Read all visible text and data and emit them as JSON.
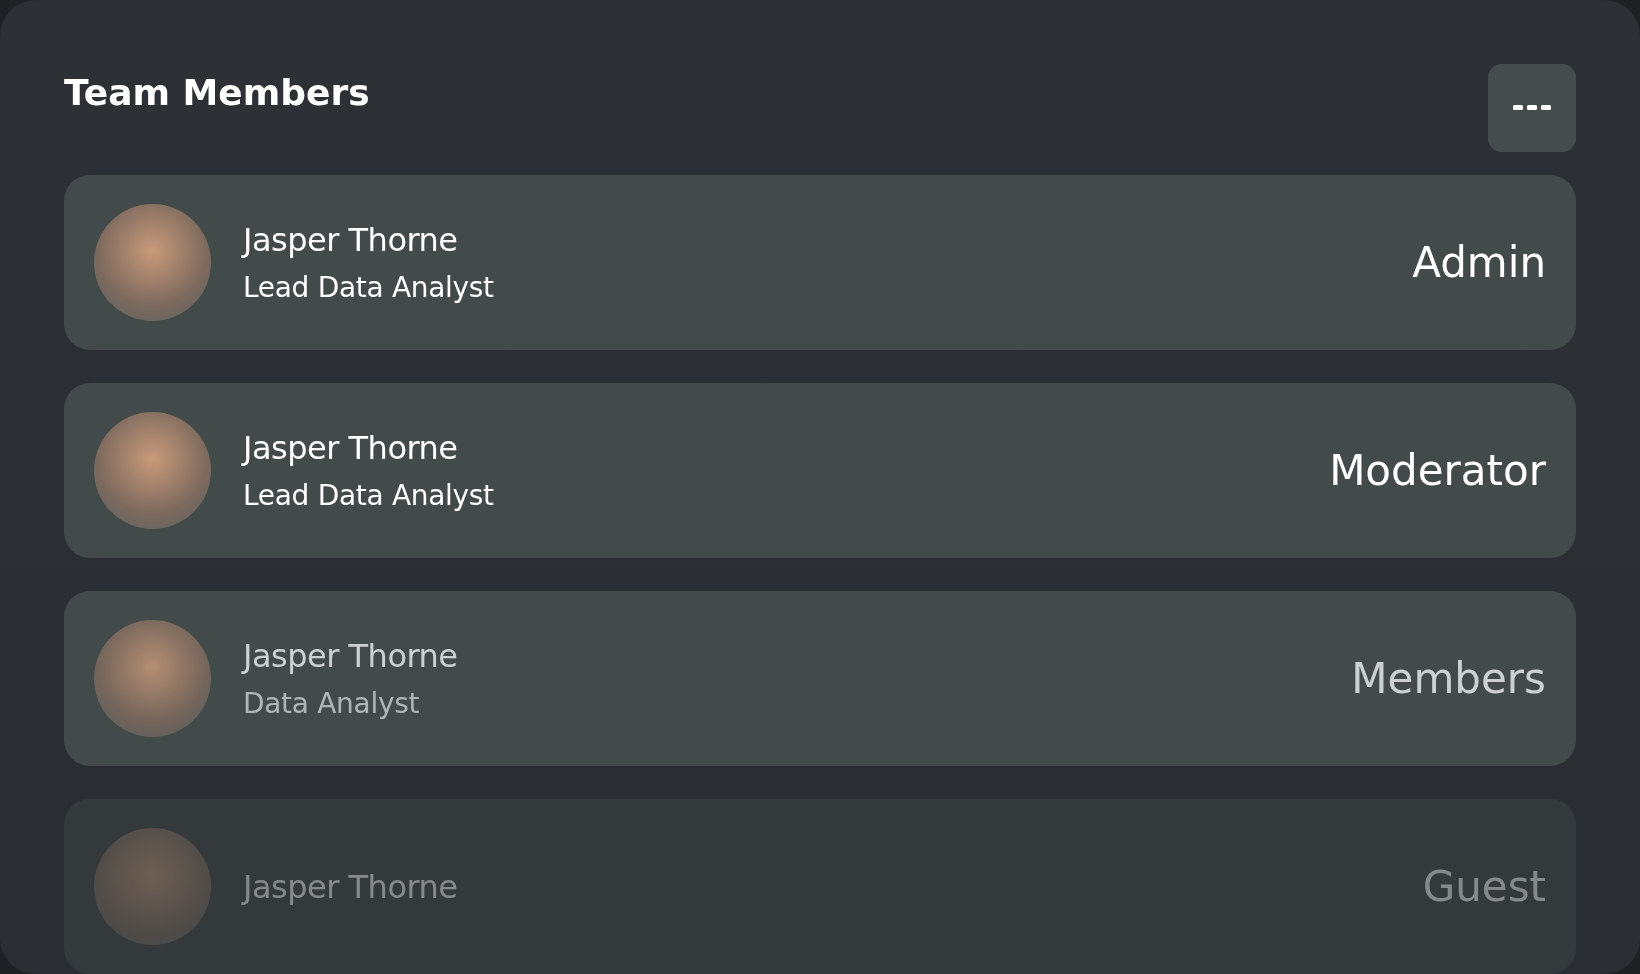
{
  "title": "Team Members",
  "members": [
    {
      "name": "Jasper Thorne",
      "position": "Lead Data Analyst",
      "role": "Admin",
      "kind": "normal"
    },
    {
      "name": "Jasper Thorne",
      "position": "Lead Data Analyst",
      "role": "Moderator",
      "kind": "normal"
    },
    {
      "name": "Jasper Thorne",
      "position": "Data Analyst",
      "role": "Members",
      "kind": "dim"
    },
    {
      "name": "Jasper Thorne",
      "role": "Guest",
      "kind": "faded"
    }
  ]
}
